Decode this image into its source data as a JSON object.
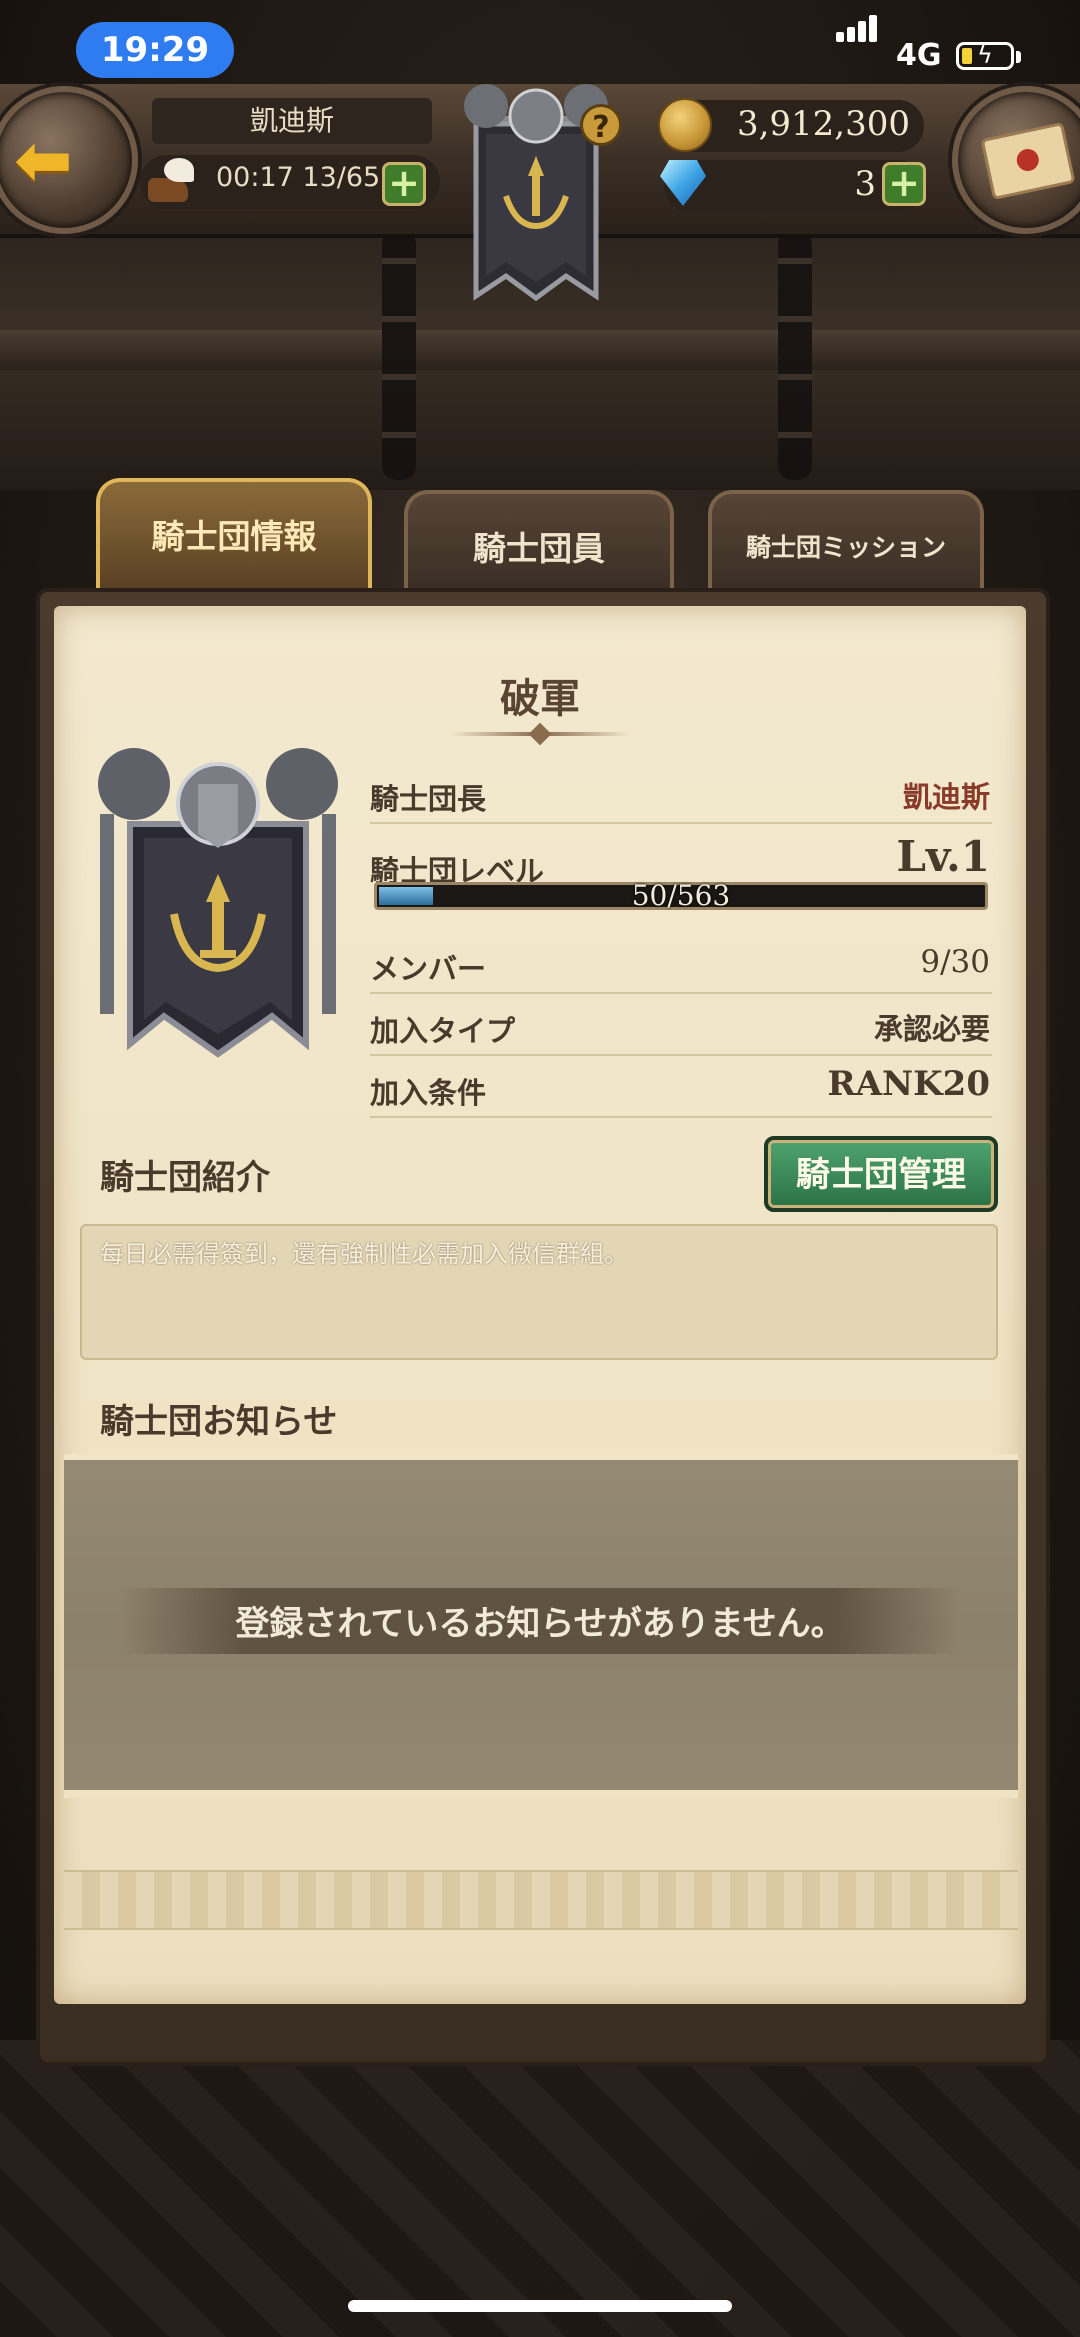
{
  "status": {
    "time": "19:29",
    "network": "4G"
  },
  "header": {
    "player_name": "凱迪斯",
    "stamina_timer": "00:17",
    "stamina": "13/65",
    "gold": "3,912,300",
    "gems": "3",
    "add_label": "+",
    "help_label": "?"
  },
  "tabs": [
    {
      "label": "騎士団情報",
      "active": true
    },
    {
      "label": "騎士団員",
      "active": false
    },
    {
      "label": "騎士団ミッション",
      "active": false
    }
  ],
  "guild": {
    "name": "破軍",
    "leader_label": "騎士団長",
    "leader": "凱迪斯",
    "level_label": "騎士団レベル",
    "level": "Lv.1",
    "xp": "50/563",
    "xp_fraction": 0.089,
    "members_label": "メンバー",
    "members": "9/30",
    "join_type_label": "加入タイプ",
    "join_type": "承認必要",
    "join_condition_label": "加入条件",
    "join_condition": "RANK20"
  },
  "intro": {
    "title": "騎士団紹介",
    "manage_button": "騎士団管理",
    "text": "每日必需得簽到，還有強制性必需加入微信群組。"
  },
  "notice": {
    "title": "騎士団お知らせ",
    "empty": "登録されているお知らせがありません。"
  },
  "colors": {
    "accent_gold": "#e0b65a",
    "manage_green": "#2b7145",
    "xp_blue": "#2d6e9c"
  }
}
